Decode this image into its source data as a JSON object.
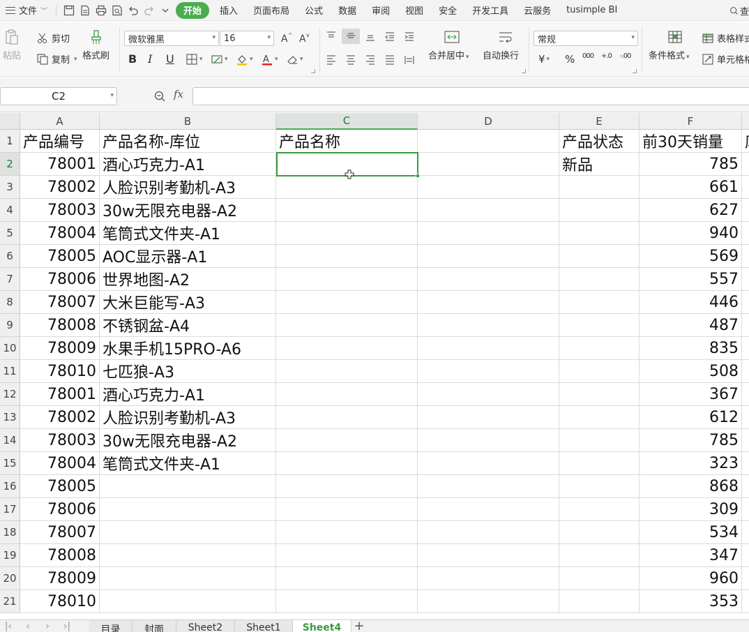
{
  "menubar": {
    "file_label": "文件",
    "tabs": [
      "开始",
      "插入",
      "页面布局",
      "公式",
      "数据",
      "审阅",
      "视图",
      "安全",
      "开发工具",
      "云服务",
      "tusimple BI"
    ],
    "active_tab": "开始",
    "search_partial": "查",
    "accent_color": "#4aad4f"
  },
  "ribbon": {
    "paste_label": "粘贴",
    "cut_label": "剪切",
    "copy_label": "复制",
    "format_painter_label": "格式刷",
    "font_name": "微软雅黑",
    "font_size": "16",
    "merge_label": "合并居中",
    "wrap_label": "自动换行",
    "number_format": "常规",
    "conditional_format_label": "条件格式",
    "table_style_label": "表格样式",
    "cell_style_label": "单元格格式",
    "bold_label": "B",
    "italic_label": "I",
    "underline_label": "U",
    "currency_symbol": "¥",
    "percent_symbol": "%",
    "thousands_symbol": "000",
    "increase_decimal": "+.0",
    "decrease_decimal": "-.00"
  },
  "formula_bar": {
    "name_box": "C2",
    "fx_label": "fx",
    "formula": ""
  },
  "sheet": {
    "columns": [
      "A",
      "B",
      "C",
      "D",
      "E",
      "F"
    ],
    "selected_col": "C",
    "selected_row": 2,
    "header_row": [
      "产品编号",
      "产品名称-库位",
      "产品名称",
      "",
      "产品状态",
      "前30天销量",
      "库"
    ],
    "rows": [
      {
        "num": 2,
        "a": "78001",
        "b": "酒心巧克力-A1",
        "e": "新品",
        "f": "785"
      },
      {
        "num": 3,
        "a": "78002",
        "b": "人脸识别考勤机-A3",
        "e": "",
        "f": "661"
      },
      {
        "num": 4,
        "a": "78003",
        "b": "30w无限充电器-A2",
        "e": "",
        "f": "627"
      },
      {
        "num": 5,
        "a": "78004",
        "b": "笔筒式文件夹-A1",
        "e": "",
        "f": "940"
      },
      {
        "num": 6,
        "a": "78005",
        "b": "AOC显示器-A1",
        "e": "",
        "f": "569"
      },
      {
        "num": 7,
        "a": "78006",
        "b": "世界地图-A2",
        "e": "",
        "f": "557"
      },
      {
        "num": 8,
        "a": "78007",
        "b": "大米巨能写-A3",
        "e": "",
        "f": "446"
      },
      {
        "num": 9,
        "a": "78008",
        "b": "不锈钢盆-A4",
        "e": "",
        "f": "487"
      },
      {
        "num": 10,
        "a": "78009",
        "b": "水果手机15PRO-A6",
        "e": "",
        "f": "835"
      },
      {
        "num": 11,
        "a": "78010",
        "b": "七匹狼-A3",
        "e": "",
        "f": "508"
      },
      {
        "num": 12,
        "a": "78001",
        "b": "酒心巧克力-A1",
        "e": "",
        "f": "367"
      },
      {
        "num": 13,
        "a": "78002",
        "b": "人脸识别考勤机-A3",
        "e": "",
        "f": "612"
      },
      {
        "num": 14,
        "a": "78003",
        "b": "30w无限充电器-A2",
        "e": "",
        "f": "785"
      },
      {
        "num": 15,
        "a": "78004",
        "b": "笔筒式文件夹-A1",
        "e": "",
        "f": "323"
      },
      {
        "num": 16,
        "a": "78005",
        "b": "",
        "e": "",
        "f": "868"
      },
      {
        "num": 17,
        "a": "78006",
        "b": "",
        "e": "",
        "f": "309"
      },
      {
        "num": 18,
        "a": "78007",
        "b": "",
        "e": "",
        "f": "534"
      },
      {
        "num": 19,
        "a": "78008",
        "b": "",
        "e": "",
        "f": "347"
      },
      {
        "num": 20,
        "a": "78009",
        "b": "",
        "e": "",
        "f": "960"
      },
      {
        "num": 21,
        "a": "78010",
        "b": "",
        "e": "",
        "f": "353"
      }
    ]
  },
  "sheet_tabs": {
    "tabs": [
      "目录",
      "封面",
      "Sheet2",
      "Sheet1",
      "Sheet4"
    ],
    "active": "Sheet4",
    "add_label": "+"
  }
}
